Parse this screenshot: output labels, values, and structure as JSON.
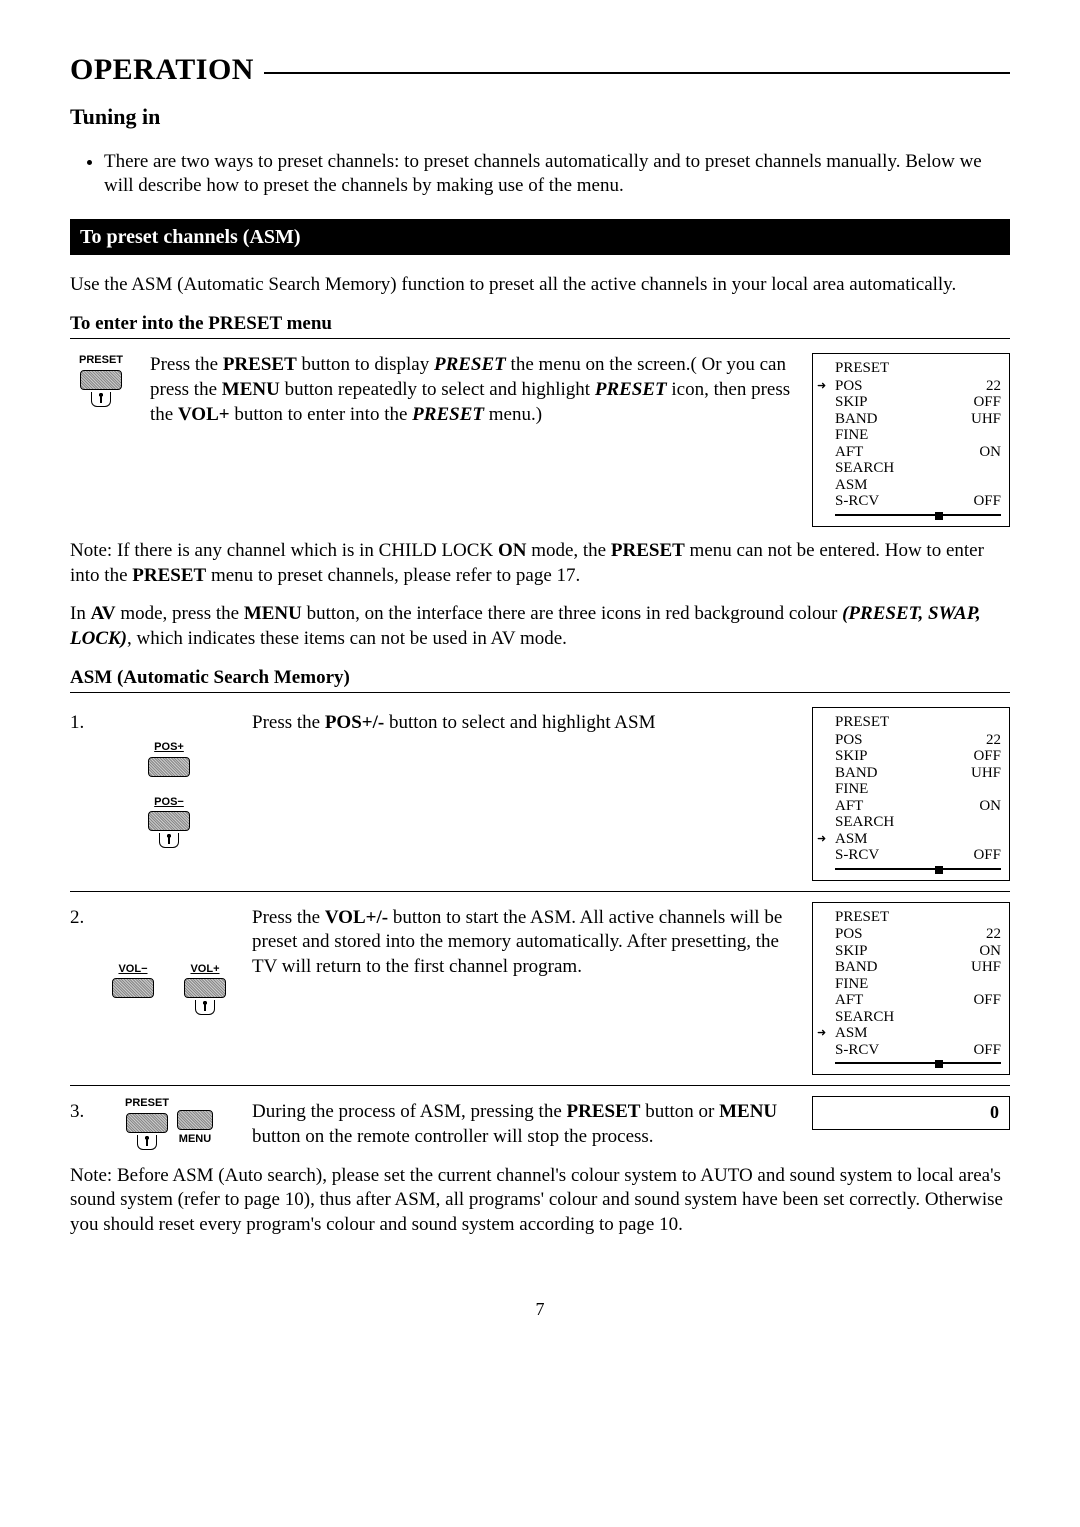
{
  "header": {
    "title": "OPERATION"
  },
  "section": {
    "title": "Tuning in"
  },
  "intro_bullet": "There are two ways to preset channels: to preset channels automatically and to preset channels manually. Below we will describe how to preset the channels by making use of the menu.",
  "blackbar": "To preset channels (ASM)",
  "asm_intro": "Use the ASM (Automatic Search Memory) function to preset all the active channels in your local area automatically.",
  "enter_heading": "To enter into the PRESET menu",
  "press_preset": {
    "label": "PRESET",
    "parts": [
      "Press the ",
      "PRESET",
      " button to display ",
      "PRESET",
      " the menu on the screen.( Or you can press the ",
      "MENU",
      " button repeatedly to select and highlight ",
      "PRESET",
      " icon, then press the ",
      "VOL+",
      " button to enter into the ",
      "PRESET",
      " menu.)"
    ]
  },
  "note1_parts": [
    "Note: If there is any channel which is in CHILD LOCK ",
    "ON",
    " mode, the ",
    "PRESET",
    " menu can not be entered. How to enter into the ",
    "PRESET",
    " menu to preset channels, please refer to page 17."
  ],
  "av_parts": [
    "In ",
    "AV",
    " mode, press the ",
    "MENU",
    " button, on the interface there are three icons in red background colour ",
    "(PRESET, SWAP, LOCK)",
    ", which indicates these items can not be used in AV mode."
  ],
  "asm_heading": "ASM (Automatic Search Memory)",
  "steps": {
    "s1": {
      "num": "1.",
      "label_top": "POS+",
      "label_bot": "POS−",
      "parts": [
        "Press the ",
        "POS+/-",
        " button to select and highlight ASM"
      ]
    },
    "s2": {
      "num": "2.",
      "label_l": "VOL−",
      "label_r": "VOL+",
      "parts": [
        "Press the ",
        "VOL+/-",
        " button to start the ASM. All active channels will be preset and stored into the memory automatically. After presetting, the TV will return to the first channel program."
      ]
    },
    "s3": {
      "num": "3.",
      "label_l": "PRESET",
      "label_r": "MENU",
      "parts": [
        "During the process of ASM, pressing the ",
        "PRESET",
        " button or ",
        "MENU",
        " button on the remote controller will stop the process."
      ]
    }
  },
  "note2": "Note: Before ASM (Auto search), please set the current channel's colour system to AUTO and sound system to local area's sound system (refer to page 10), thus after ASM, all programs' colour and sound system have been set correctly. Otherwise you should reset every program's colour and sound system according to page 10.",
  "pagenum": "7",
  "osd": {
    "title": "PRESET",
    "rows": [
      {
        "k": "POS",
        "v": "22"
      },
      {
        "k": "SKIP",
        "v": "OFF"
      },
      {
        "k": "BAND",
        "v": "UHF"
      },
      {
        "k": "FINE",
        "v": ""
      },
      {
        "k": "AFT",
        "v": "ON"
      },
      {
        "k": "SEARCH",
        "v": ""
      },
      {
        "k": "ASM",
        "v": ""
      },
      {
        "k": "S-RCV",
        "v": "OFF"
      }
    ],
    "arrow_row": 0
  },
  "osd2": {
    "title": "PRESET",
    "rows": [
      {
        "k": "POS",
        "v": "22"
      },
      {
        "k": "SKIP",
        "v": "OFF"
      },
      {
        "k": "BAND",
        "v": "UHF"
      },
      {
        "k": "FINE",
        "v": ""
      },
      {
        "k": "AFT",
        "v": "ON"
      },
      {
        "k": "SEARCH",
        "v": ""
      },
      {
        "k": "ASM",
        "v": ""
      },
      {
        "k": "S-RCV",
        "v": "OFF"
      }
    ],
    "arrow_row": 6
  },
  "osd3": {
    "title": "PRESET",
    "rows": [
      {
        "k": "POS",
        "v": "22"
      },
      {
        "k": "SKIP",
        "v": "ON"
      },
      {
        "k": "BAND",
        "v": "UHF"
      },
      {
        "k": "FINE",
        "v": ""
      },
      {
        "k": "AFT",
        "v": "OFF"
      },
      {
        "k": "SEARCH",
        "v": ""
      },
      {
        "k": "ASM",
        "v": ""
      },
      {
        "k": "S-RCV",
        "v": "OFF"
      }
    ],
    "arrow_row": 6
  },
  "osd4": {
    "value": "0"
  }
}
